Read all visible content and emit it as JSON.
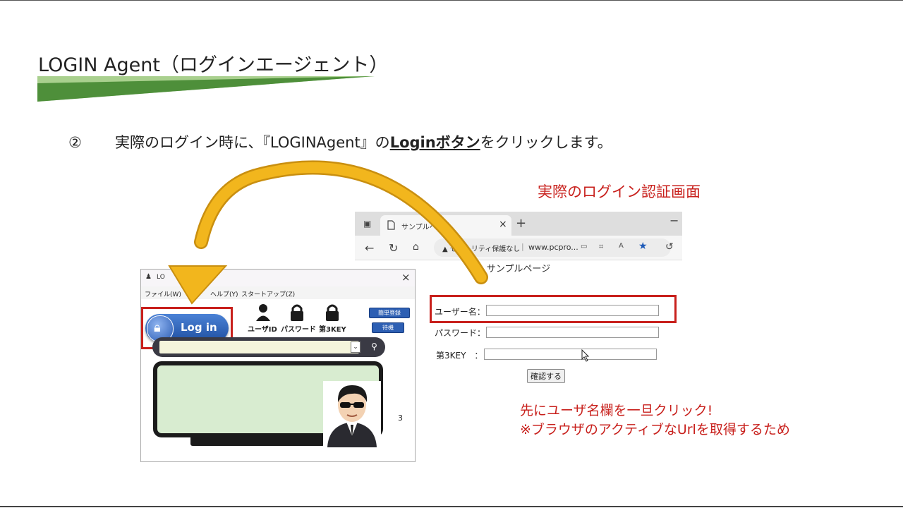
{
  "slide": {
    "title": "LOGIN Agent（ログインエージェント）",
    "step_number": "②",
    "step_text_before": "実際のログイン時に、『LOGINAgent』の",
    "step_text_emphasis": "Loginボタン",
    "step_text_after": "をクリックします。",
    "caption_auth_screen": "実際のログイン認証画面",
    "note_line1": "先にユーザ名欄を一旦クリック!",
    "note_line2": "※ブラウザのアクティブなUrlを取得するため"
  },
  "browser": {
    "tab_label": "サンプルページ",
    "tab_close": "×",
    "new_tab": "+",
    "minimize": "−",
    "security_text": "セキュリティ保護なし",
    "url": "www.pcpro...",
    "page_heading": "サンプルページ",
    "form": {
      "username_label": "ユーザー名：",
      "password_label": "パスワード：",
      "third_key_label": "第3KEY　：",
      "username_value": "",
      "password_value": "",
      "third_key_value": "",
      "confirm_button": "確認する"
    }
  },
  "app": {
    "title": "LO",
    "close": "×",
    "menu": [
      "ファイル(W)",
      "ヘルプ(Y)",
      "スタートアップ(Z)"
    ],
    "login_button": "Log in",
    "cred_labels": [
      "ユーザID",
      "パスワード",
      "第3KEY"
    ],
    "quick_register_button": "簡単登録",
    "standby_button": "待機",
    "side_number": "3",
    "url_value": ""
  },
  "colors": {
    "accent_red": "#c8201c",
    "title_bar_green_dark": "#4e8f3a",
    "title_bar_green_light": "#a9d08e",
    "arrow_yellow": "#f2b61d",
    "app_blue": "#2d5fb3"
  },
  "icons": {
    "tab": "page-icon",
    "back": "back-arrow-icon",
    "reload": "reload-icon",
    "home": "home-icon",
    "warning": "warning-icon",
    "favorite": "star-icon",
    "lock": "lock-icon",
    "user": "user-icon",
    "pin": "pin-icon",
    "agent": "agent-avatar-icon",
    "cursor": "mouse-cursor-icon"
  }
}
